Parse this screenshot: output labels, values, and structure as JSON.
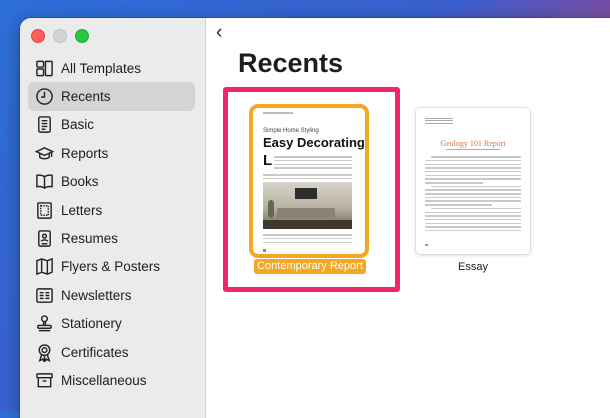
{
  "sidebar": {
    "items": [
      {
        "label": "All Templates",
        "icon": "grid-icon",
        "active": false
      },
      {
        "label": "Recents",
        "icon": "clock-icon",
        "active": true
      },
      {
        "label": "Basic",
        "icon": "document-icon",
        "active": false
      },
      {
        "label": "Reports",
        "icon": "graduation-cap-icon",
        "active": false
      },
      {
        "label": "Books",
        "icon": "book-icon",
        "active": false
      },
      {
        "label": "Letters",
        "icon": "letter-icon",
        "active": false
      },
      {
        "label": "Resumes",
        "icon": "resume-icon",
        "active": false
      },
      {
        "label": "Flyers & Posters",
        "icon": "map-icon",
        "active": false
      },
      {
        "label": "Newsletters",
        "icon": "newspaper-icon",
        "active": false
      },
      {
        "label": "Stationery",
        "icon": "stamp-icon",
        "active": false
      },
      {
        "label": "Certificates",
        "icon": "ribbon-icon",
        "active": false
      },
      {
        "label": "Miscellaneous",
        "icon": "archive-box-icon",
        "active": false
      }
    ]
  },
  "main": {
    "back_glyph": "‹",
    "title": "Recents",
    "templates": [
      {
        "label": "Contemporary Report",
        "selected": true,
        "preview": {
          "kicker": "Simple Home Styling",
          "heading": "Easy Decorating",
          "dropcap": "L"
        }
      },
      {
        "label": "Essay",
        "selected": false,
        "preview": {
          "heading": "Geology 101 Report"
        }
      }
    ]
  },
  "colors": {
    "selection_orange": "#f5a623",
    "highlight_pink": "#f2246e",
    "sidebar_active": "#d4d4d4"
  }
}
